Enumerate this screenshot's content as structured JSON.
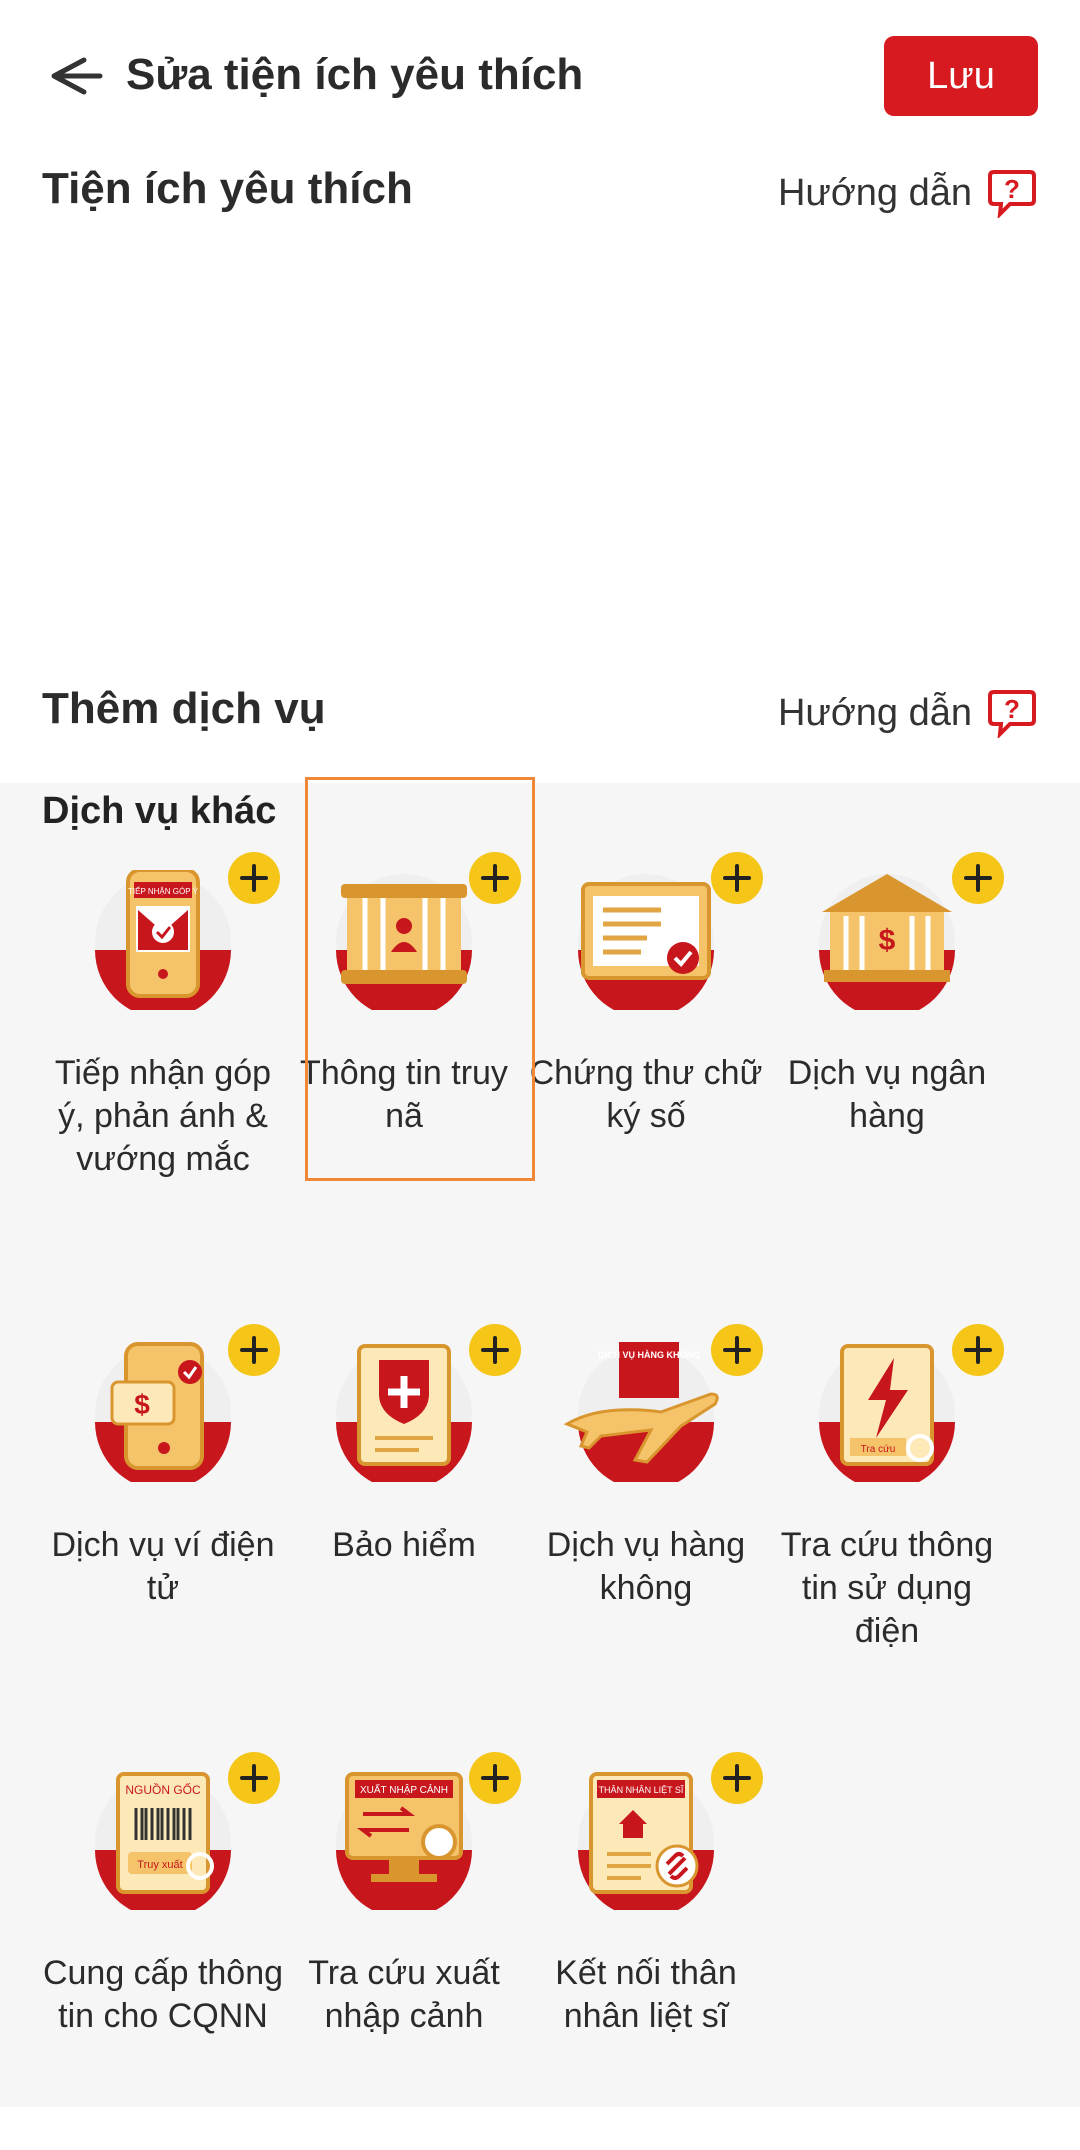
{
  "header": {
    "title": "Sửa tiện ích yêu thích",
    "save_label": "Lưu"
  },
  "favorites": {
    "title": "Tiện ích yêu thích",
    "guide_label": "Hướng dẫn"
  },
  "add_service": {
    "title": "Thêm dịch vụ",
    "guide_label": "Hướng dẫn"
  },
  "group": {
    "title": "Dịch vụ khác"
  },
  "services": [
    {
      "label": "Tiếp nhận góp ý, phản ánh & vướng mắc",
      "icon": "feedback-phone-icon",
      "badge": "TIẾP NHẬN GÓP Ý"
    },
    {
      "label": "Thông tin truy nã",
      "icon": "wanted-jail-icon"
    },
    {
      "label": "Chứng thư chữ ký số",
      "icon": "digital-certificate-icon"
    },
    {
      "label": "Dịch vụ ngân hàng",
      "icon": "bank-icon"
    },
    {
      "label": "Dịch vụ ví điện tử",
      "icon": "e-wallet-icon"
    },
    {
      "label": "Bảo hiểm",
      "icon": "insurance-icon"
    },
    {
      "label": "Dịch vụ hàng không",
      "icon": "airplane-icon",
      "badge": "DỊCH VỤ HÀNG KHÔNG"
    },
    {
      "label": "Tra cứu thông tin sử dụng điện",
      "icon": "electricity-icon",
      "badge": "Tra cứu"
    },
    {
      "label": "Cung cấp thông tin cho CQNN",
      "icon": "barcode-origin-icon",
      "badge": "NGUỒN GỐC",
      "badge2": "Truy xuất"
    },
    {
      "label": "Tra cứu xuất nhập cảnh",
      "icon": "immigration-icon",
      "badge": "XUẤT NHẬP CẢNH"
    },
    {
      "label": "Kết nối thân nhân liệt sĩ",
      "icon": "martyr-relatives-icon",
      "badge": "THÂN NHÂN LIỆT SĨ"
    }
  ],
  "colors": {
    "accent": "#d71920",
    "gold": "#f5c518",
    "highlight": "#f0883a"
  }
}
